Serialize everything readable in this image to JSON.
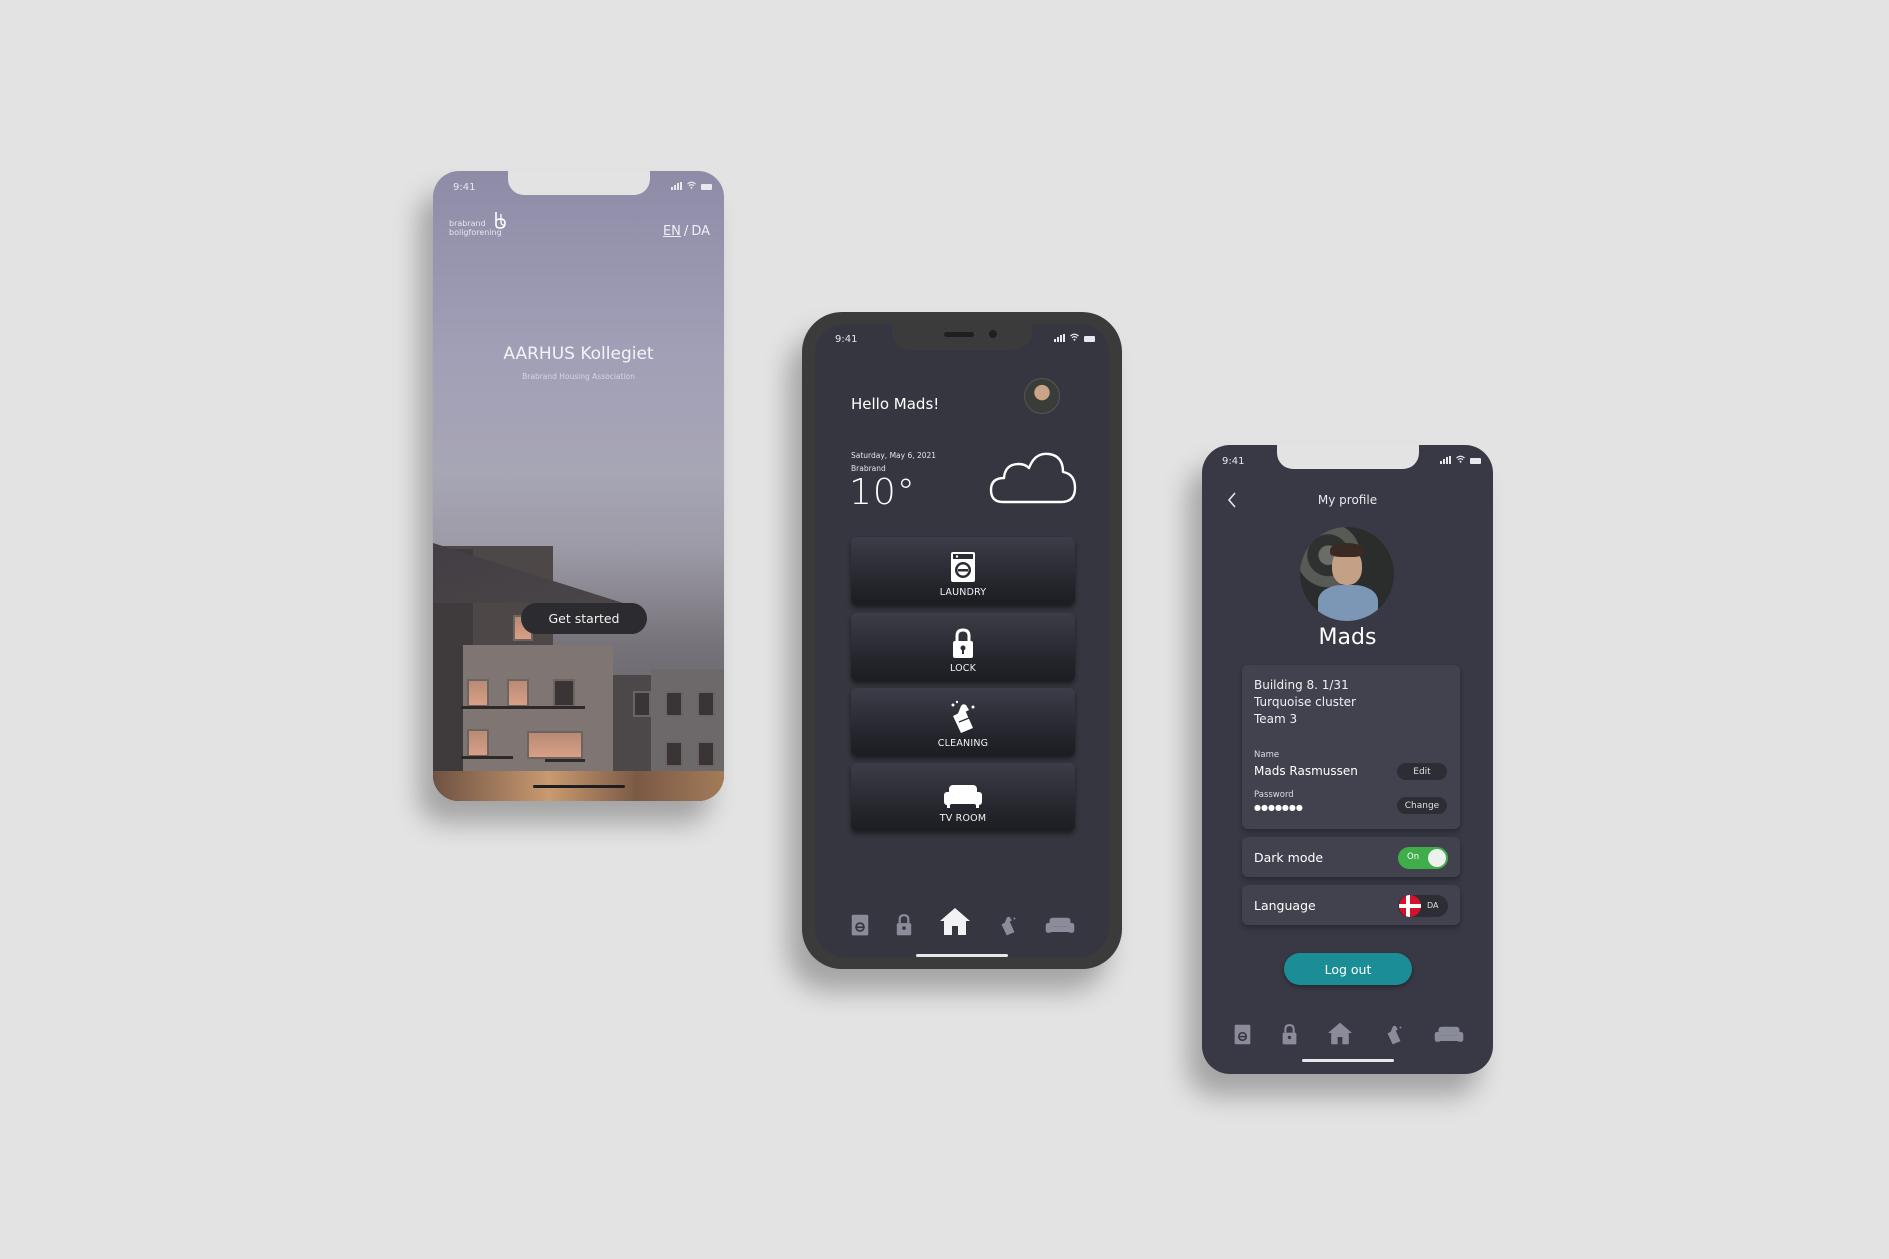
{
  "status_bar": {
    "time": "9:41"
  },
  "welcome_screen": {
    "logo_text_line1": "brabrand",
    "logo_text_line2": "boligforening",
    "lang_en": "EN",
    "lang_sep": "/",
    "lang_da": "DA",
    "title": "AARHUS Kollegiet",
    "subtitle": "Brabrand Housing Association",
    "cta_label": "Get started"
  },
  "home_screen": {
    "greeting": "Hello Mads!",
    "date": "Saturday, May 6, 2021",
    "location": "Brabrand",
    "temperature": "10°",
    "weather_icon": "cloud-icon",
    "tiles": [
      {
        "label": "LAUNDRY",
        "icon": "washing-machine-icon"
      },
      {
        "label": "LOCK",
        "icon": "lock-icon"
      },
      {
        "label": "CLEANING",
        "icon": "cleaning-icon"
      },
      {
        "label": "TV ROOM",
        "icon": "sofa-icon"
      }
    ],
    "nav_items": [
      "washing-machine-icon",
      "lock-icon",
      "home-icon",
      "cleaning-icon",
      "sofa-icon"
    ]
  },
  "profile_screen": {
    "title": "My profile",
    "name_heading": "Mads",
    "address_line1": "Building 8. 1/31",
    "address_line2": "Turquoise cluster",
    "address_line3": "Team 3",
    "name_label": "Name",
    "name_value": "Mads Rasmussen",
    "edit_label": "Edit",
    "password_label": "Password",
    "password_value": "●●●●●●●",
    "change_label": "Change",
    "dark_mode_label": "Dark mode",
    "dark_mode_state": "On",
    "dark_mode_on": true,
    "language_label": "Language",
    "language_value": "DA",
    "logout_label": "Log out",
    "accent_color": "#1b8d97",
    "toggle_color": "#3fae4a"
  }
}
